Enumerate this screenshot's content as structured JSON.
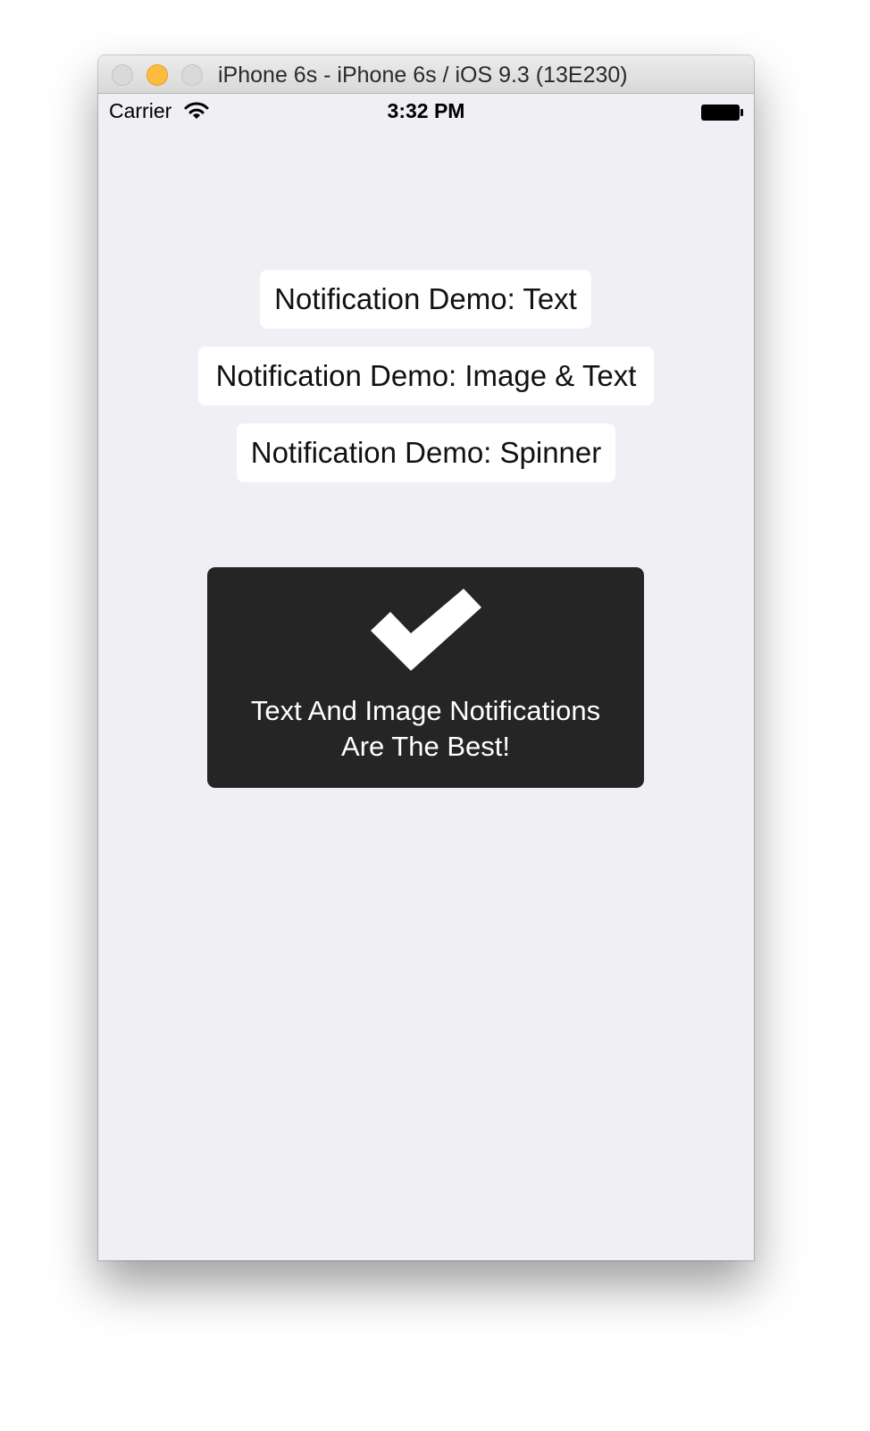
{
  "window": {
    "title": "iPhone 6s - iPhone 6s / iOS 9.3 (13E230)",
    "controls": [
      "close",
      "minimize",
      "zoom"
    ]
  },
  "statusbar": {
    "carrier": "Carrier",
    "time": "3:32 PM",
    "wifi_icon": "wifi-icon",
    "battery_icon": "battery-full-icon"
  },
  "buttons": {
    "text_demo": "Notification Demo: Text",
    "image_text_demo": "Notification Demo: Image & Text",
    "spinner_demo": "Notification Demo: Spinner"
  },
  "notification": {
    "icon": "checkmark-icon",
    "line1": "Text And Image Notifications",
    "line2": "Are The Best!"
  },
  "colors": {
    "screen_background": "#efeff4",
    "button_background": "#ffffff",
    "hud_background": "#252525",
    "minimize_light": "#fdbc40"
  }
}
